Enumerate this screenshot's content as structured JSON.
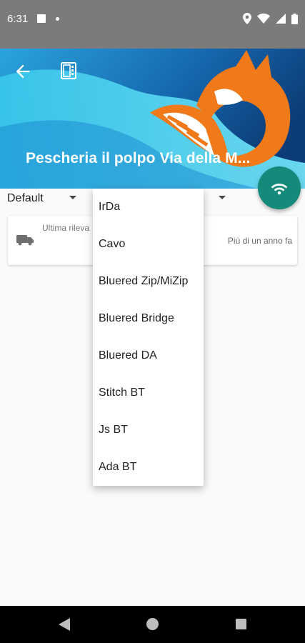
{
  "status_bar": {
    "time": "6:31"
  },
  "header": {
    "title": "Pescheria il polpo Via della M..."
  },
  "filters": {
    "left_selected": "Default"
  },
  "card": {
    "label": "Ultima rileva",
    "value": "Più di un anno fa"
  },
  "dropdown": {
    "options": [
      "IrDa",
      "Cavo",
      "Bluered Zip/MiZip",
      "Bluered Bridge",
      "Bluered DA",
      "Stitch BT",
      "Js BT",
      "Ada BT"
    ]
  },
  "colors": {
    "fab": "#138a7a",
    "status_bar": "#7b7b7b",
    "fox_orange": "#f07a1a"
  },
  "icons": [
    "back-arrow-icon",
    "device-icon",
    "wifi-icon",
    "truck-icon",
    "dropdown-arrow-icon"
  ]
}
